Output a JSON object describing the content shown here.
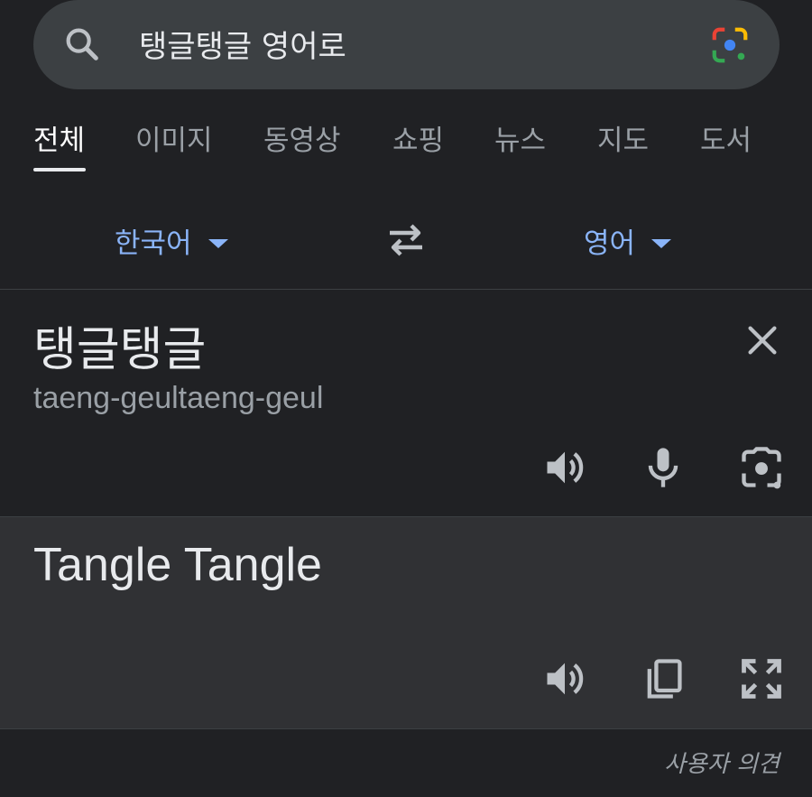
{
  "search": {
    "query": "탱글탱글 영어로"
  },
  "tabs": [
    {
      "label": "전체",
      "active": true
    },
    {
      "label": "이미지"
    },
    {
      "label": "동영상"
    },
    {
      "label": "쇼핑"
    },
    {
      "label": "뉴스"
    },
    {
      "label": "지도"
    },
    {
      "label": "도서"
    }
  ],
  "translator": {
    "source_lang": "한국어",
    "target_lang": "영어",
    "source_text": "탱글탱글",
    "romanization": "taeng-geultaeng-geul",
    "result_text": "Tangle Tangle"
  },
  "footer": {
    "feedback_label": "사용자 의견"
  },
  "icons": {
    "search": "search-icon",
    "lens": "google-lens-icon",
    "swap": "swap-languages-icon",
    "close": "close-icon",
    "speaker": "speaker-icon",
    "mic": "microphone-icon",
    "camera": "camera-icon",
    "copy": "copy-icon",
    "fullscreen": "fullscreen-icon"
  },
  "colors": {
    "background": "#202124",
    "panel": "#303134",
    "accent": "#8ab4f8",
    "muted": "#9aa0a6"
  }
}
